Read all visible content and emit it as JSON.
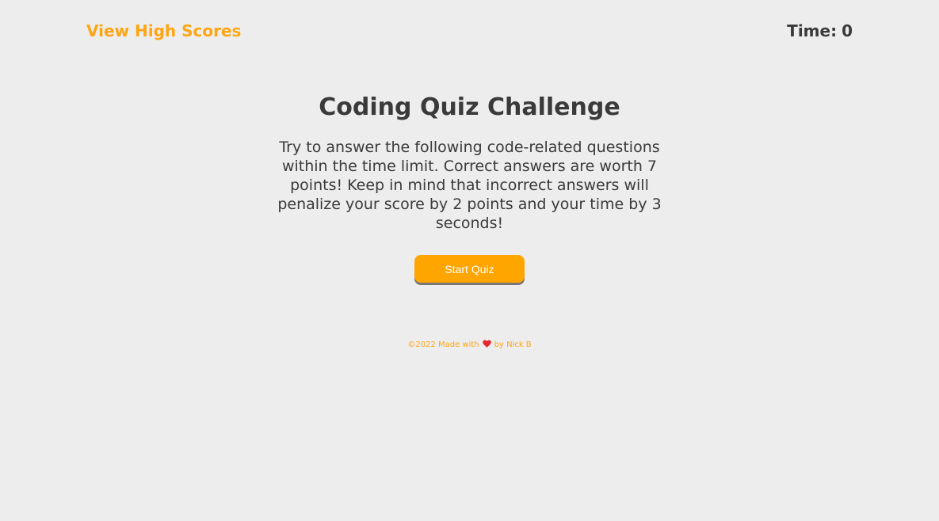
{
  "header": {
    "high_scores_link": "View High Scores",
    "timer_label": "Time:",
    "timer_value": "0"
  },
  "main": {
    "title": "Coding Quiz Challenge",
    "intro": "Try to answer the following code-related questions within the time limit. Correct answers are worth 7 points! Keep in mind that incorrect answers will penalize your score by 2 points and your time by 3 seconds!",
    "start_button": "Start Quiz"
  },
  "footer": {
    "prefix": "©2022 Made with",
    "icon": "heart-icon",
    "suffix": "by Nick B"
  },
  "colors": {
    "background": "#ededed",
    "accent": "#ffa500",
    "text": "#3a3a3a",
    "heart": "#e8262e"
  }
}
